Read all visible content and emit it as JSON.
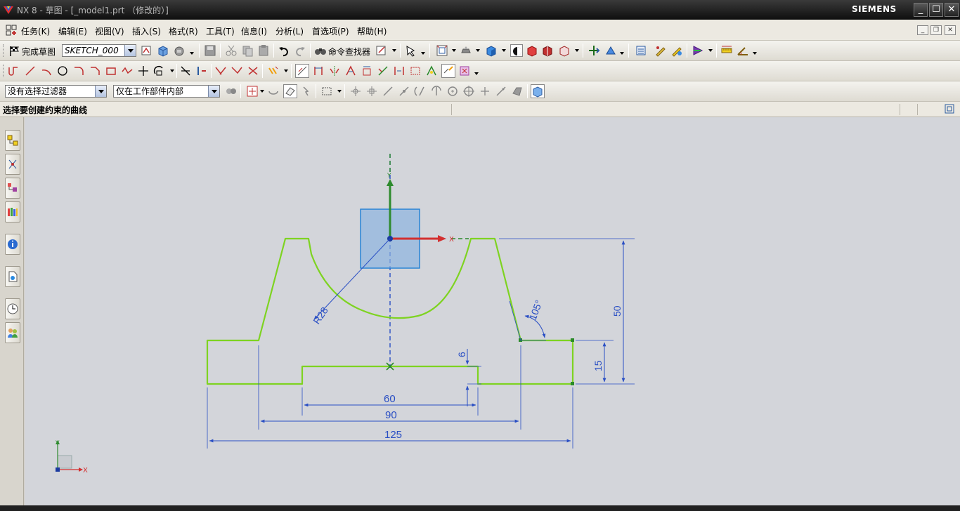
{
  "window": {
    "title": "NX 8 - 草图 - [_model1.prt （修改的）]",
    "brand": "SIEMENS",
    "controls": [
      "_",
      "☐",
      "✕"
    ]
  },
  "menu": {
    "items": [
      "任务(K)",
      "编辑(E)",
      "视图(V)",
      "插入(S)",
      "格式(R)",
      "工具(T)",
      "信息(I)",
      "分析(L)",
      "首选项(P)",
      "帮助(H)"
    ]
  },
  "toolbar": {
    "finish_sketch_label": "完成草图",
    "sketch_name": "SKETCH_000",
    "command_finder_label": "命令查找器"
  },
  "selection_bar": {
    "filter_value": "没有选择过滤器",
    "scope_value": "仅在工作部件内部"
  },
  "cue_line": {
    "text": "选择要创建约束的曲线"
  },
  "sketch": {
    "profile_color": "#7ed321",
    "dim_color": "#2a4fc4",
    "axis_x_label": "X",
    "axis_y_label": "Y",
    "dimensions": {
      "width_total": "125",
      "width_mid": "90",
      "width_slot": "60",
      "height_total": "50",
      "step_height": "15",
      "slot_depth": "6",
      "arc_radius": "R28",
      "angle": "105°"
    }
  },
  "triad": {
    "x_label": "X",
    "y_label": "Y"
  },
  "colors": {
    "titlebar": "#1a1a1a",
    "canvas": "#d3d5da",
    "axis_x": "#d32f2f",
    "axis_y": "#2e8b2e",
    "origin_square": "#8db4e0"
  }
}
